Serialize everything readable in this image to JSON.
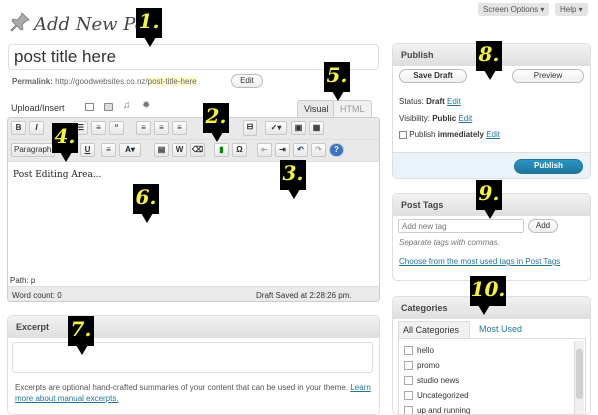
{
  "header": {
    "title": "Add New Post",
    "screen_options": "Screen Options",
    "help": "Help"
  },
  "title_field": {
    "value": "post title here"
  },
  "permalink": {
    "label": "Permalink:",
    "base": "http://goodwebsites.co.nz/",
    "slug": "post-title-here",
    "edit": "Edit"
  },
  "media": {
    "upload_insert": "Upload/Insert"
  },
  "editor": {
    "tab_visual": "Visual",
    "tab_html": "HTML",
    "paragraph": "Paragraph",
    "content": "Post Editing Area...",
    "path": "Path: p",
    "word_count": "Word count: 0",
    "draft_saved": "Draft Saved at 2:28:26 pm."
  },
  "excerpt": {
    "heading": "Excerpt",
    "help": "Excerpts are optional hand-crafted summaries of your content that can be used in your theme.",
    "learn_more": "Learn more about manual excerpts."
  },
  "publish": {
    "heading": "Publish",
    "save_draft": "Save Draft",
    "preview": "Preview",
    "status_label": "Status:",
    "status_value": "Draft",
    "status_edit": "Edit",
    "visibility_label": "Visibility:",
    "visibility_value": "Public",
    "visibility_edit": "Edit",
    "publish_label": "Publish",
    "publish_when": "immediately",
    "publish_edit": "Edit",
    "publish_button": "Publish"
  },
  "tags": {
    "heading": "Post Tags",
    "placeholder": "Add new tag",
    "add": "Add",
    "hint": "Separate tags with commas.",
    "choose": "Choose from the most used tags in Post Tags"
  },
  "categories": {
    "heading": "Categories",
    "tab_all": "All Categories",
    "tab_used": "Most Used",
    "items": [
      "hello",
      "promo",
      "studio news",
      "Uncategorized",
      "up and running"
    ]
  },
  "callouts": [
    "1.",
    "2.",
    "3.",
    "4.",
    "5.",
    "6.",
    "7.",
    "8.",
    "9.",
    "10."
  ]
}
